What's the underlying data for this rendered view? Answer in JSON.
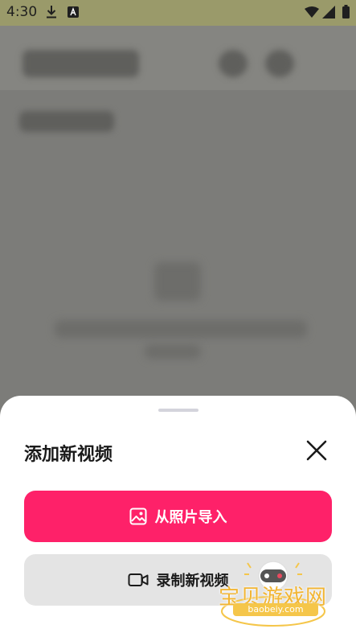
{
  "status_bar": {
    "time": "4:30",
    "icons": [
      "download-icon",
      "app-notification-icon",
      "wifi-icon",
      "signal-icon",
      "battery-icon"
    ]
  },
  "sheet": {
    "title": "添加新视频",
    "close_icon": "close-icon",
    "import_button": {
      "label": "从照片导入",
      "icon": "image-icon"
    },
    "record_button": {
      "label": "录制新视频",
      "icon": "video-camera-icon"
    }
  },
  "watermark": {
    "text": "宝贝游戏网",
    "url": "baobeiy.com"
  },
  "colors": {
    "primary": "#fe2169",
    "secondary_bg": "#e4e4e4",
    "overlay": "#7a7a76",
    "status_bar_bg": "#9a9a6a"
  }
}
